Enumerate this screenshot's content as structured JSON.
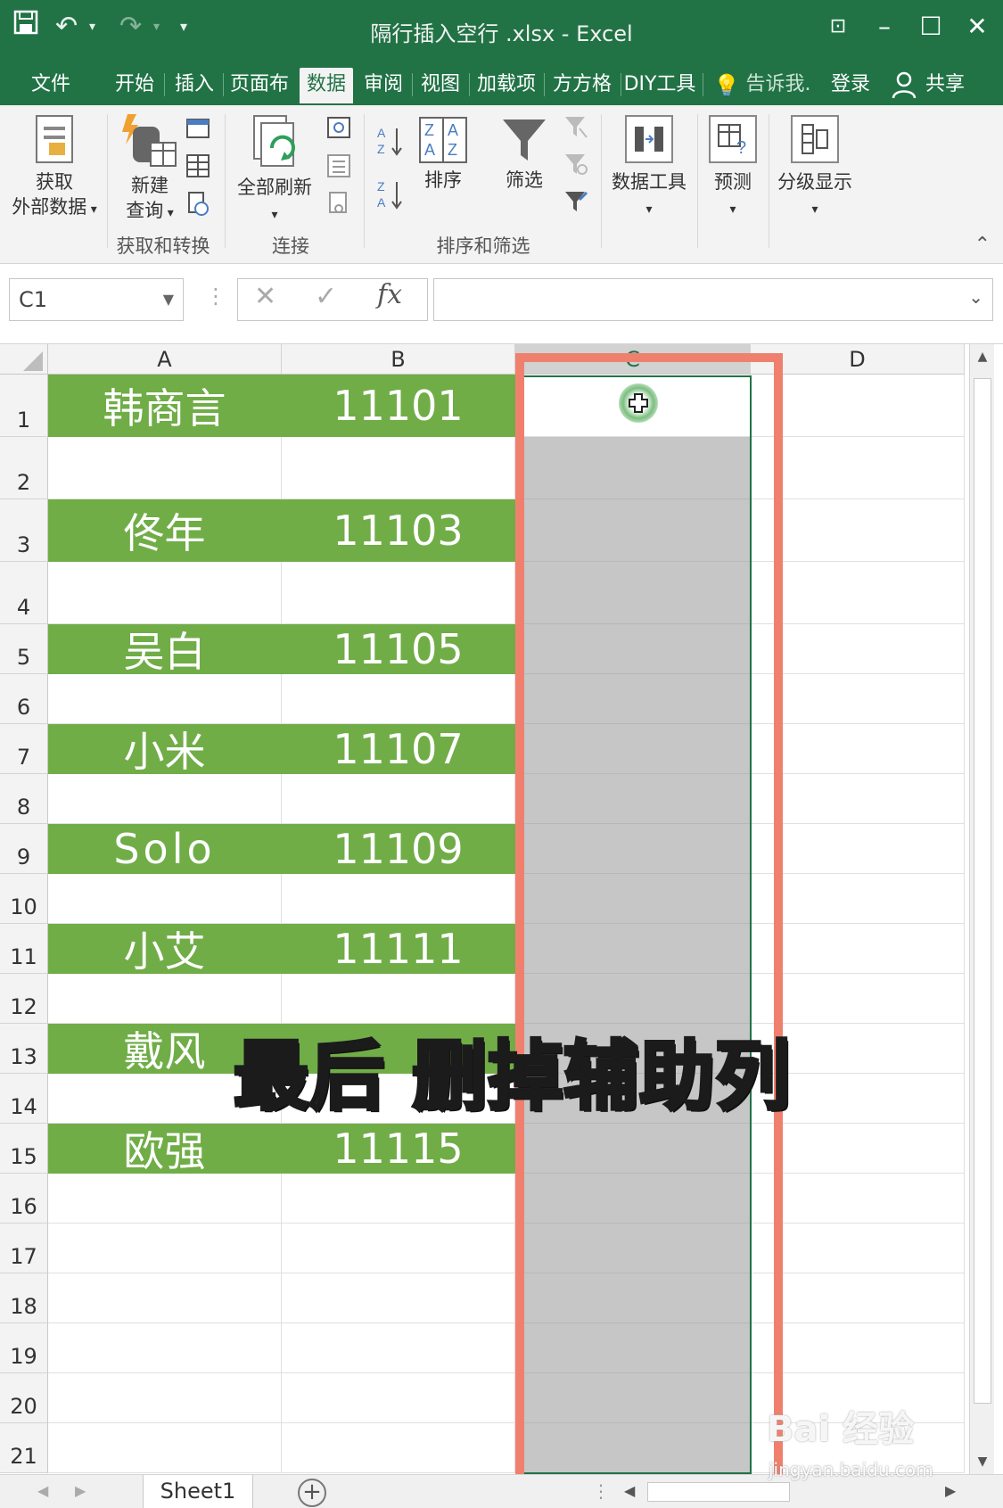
{
  "window": {
    "title": "隔行插入空行 .xlsx - Excel"
  },
  "tabs": [
    {
      "label": "文件"
    },
    {
      "label": "开始"
    },
    {
      "label": "插入"
    },
    {
      "label": "页面布"
    },
    {
      "label": "数据",
      "active": true
    },
    {
      "label": "审阅"
    },
    {
      "label": "视图"
    },
    {
      "label": "加载项"
    },
    {
      "label": "方方格"
    },
    {
      "label": "DIY工具"
    }
  ],
  "tellme": "告诉我.",
  "login": "登录",
  "share": "共享",
  "ribbon": {
    "get_external_line1": "获取",
    "get_external_line2": "外部数据",
    "new_query_line1": "新建",
    "new_query_line2": "查询",
    "group_get_transform": "获取和转换",
    "refresh_all": "全部刷新",
    "group_connections": "连接",
    "sort": "排序",
    "filter": "筛选",
    "group_sort_filter": "排序和筛选",
    "data_tools": "数据工具",
    "forecast": "预测",
    "outline": "分级显示"
  },
  "formula_bar": {
    "name_box": "C1",
    "formula": ""
  },
  "columns": [
    "A",
    "B",
    "C",
    "D"
  ],
  "rows": [
    {
      "n": "1",
      "a": "韩商言",
      "b": "11101"
    },
    {
      "n": "2",
      "a": "",
      "b": ""
    },
    {
      "n": "3",
      "a": "佟年",
      "b": "11103"
    },
    {
      "n": "4",
      "a": "",
      "b": ""
    },
    {
      "n": "5",
      "a": "吴白",
      "b": "11105"
    },
    {
      "n": "6",
      "a": "",
      "b": ""
    },
    {
      "n": "7",
      "a": "小米",
      "b": "11107"
    },
    {
      "n": "8",
      "a": "",
      "b": ""
    },
    {
      "n": "9",
      "a": "Solo",
      "b": "11109"
    },
    {
      "n": "10",
      "a": "",
      "b": ""
    },
    {
      "n": "11",
      "a": "小艾",
      "b": "11111"
    },
    {
      "n": "12",
      "a": "",
      "b": ""
    },
    {
      "n": "13",
      "a": "戴风",
      "b": ""
    },
    {
      "n": "14",
      "a": "",
      "b": ""
    },
    {
      "n": "15",
      "a": "欧强",
      "b": "11115"
    },
    {
      "n": "16",
      "a": "",
      "b": ""
    },
    {
      "n": "17",
      "a": "",
      "b": ""
    },
    {
      "n": "18",
      "a": "",
      "b": ""
    },
    {
      "n": "19",
      "a": "",
      "b": ""
    },
    {
      "n": "20",
      "a": "",
      "b": ""
    },
    {
      "n": "21",
      "a": "",
      "b": ""
    }
  ],
  "caption": "最后 删掉辅助列",
  "sheet_tab": "Sheet1",
  "watermark": "Bai 经验",
  "watermark_url": "jingyan.baidu.com",
  "colors": {
    "excel_green": "#217346",
    "row_fill": "#70ad47",
    "highlight": "#f0806e",
    "caption": "#2fa4e0"
  }
}
